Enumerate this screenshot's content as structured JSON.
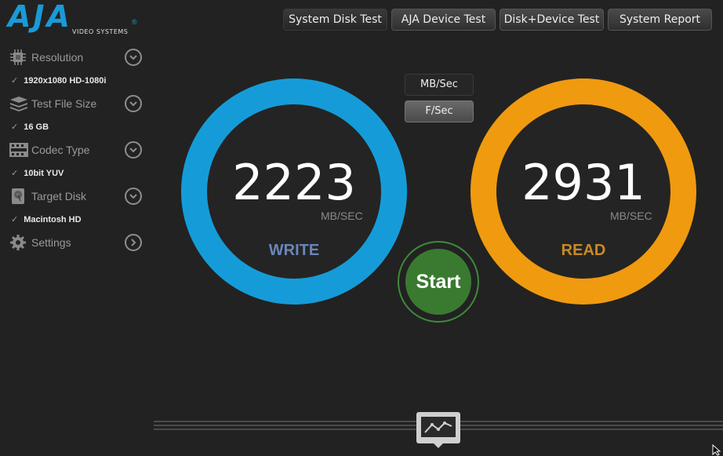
{
  "logo": {
    "letters": "AJA",
    "registered": "®",
    "subtitle": "VIDEO SYSTEMS"
  },
  "toolbar": [
    {
      "label": "System Disk Test",
      "active": true
    },
    {
      "label": "AJA Device Test",
      "active": false
    },
    {
      "label": "Disk+Device Test",
      "active": false
    },
    {
      "label": "System Report",
      "active": false
    }
  ],
  "sidebar": [
    {
      "label": "Resolution",
      "value": "1920x1080 HD-1080i",
      "icon": "chip-icon",
      "expander": "chevron-down"
    },
    {
      "label": "Test File Size",
      "value": "16 GB",
      "icon": "stack-icon",
      "expander": "chevron-down"
    },
    {
      "label": "Codec Type",
      "value": "10bit YUV",
      "icon": "film-strip-icon",
      "expander": "chevron-down"
    },
    {
      "label": "Target Disk",
      "value": "Macintosh HD",
      "icon": "hard-disk-icon",
      "expander": "chevron-down"
    },
    {
      "label": "Settings",
      "icon": "gear-icon",
      "expander": "chevron-right"
    }
  ],
  "checkmark": "✓",
  "units": {
    "mbsec_label": "MB/Sec",
    "fsec_label": "F/Sec",
    "selected": "F/Sec"
  },
  "write": {
    "value": "2223",
    "unit": "MB/SEC",
    "label": "WRITE",
    "color": "#159cd8"
  },
  "read": {
    "value": "2931",
    "unit": "MB/SEC",
    "label": "READ",
    "color": "#f09a0f"
  },
  "start_label": "Start",
  "colors": {
    "background": "#222222",
    "start": "#3a7a30",
    "write_label": "#6a86b8",
    "read_label": "#c98a24"
  },
  "bottom": {
    "graph_icon": "line-graph-icon"
  }
}
